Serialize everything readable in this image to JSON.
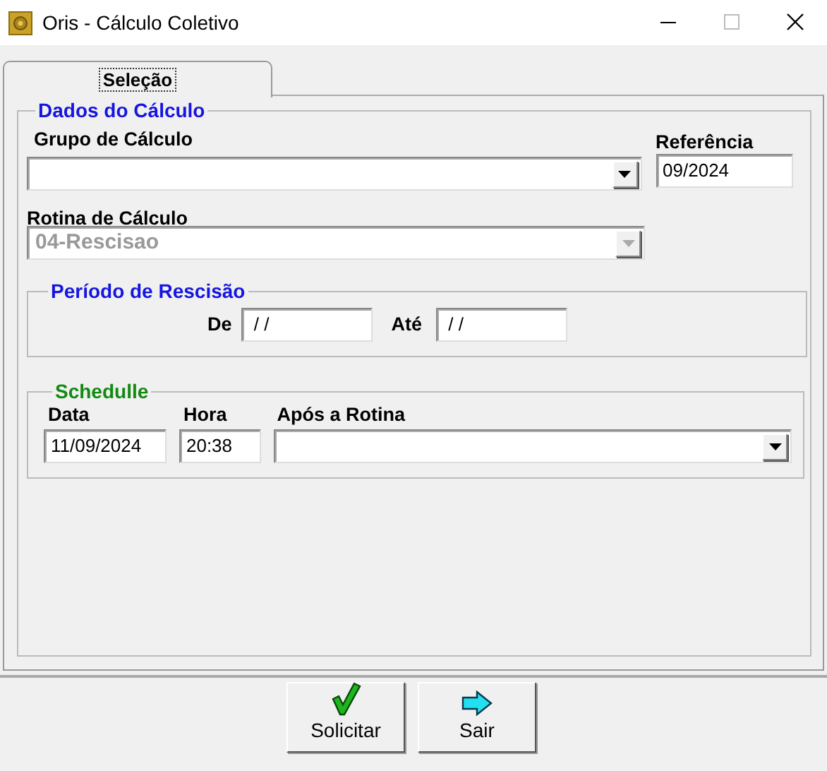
{
  "window": {
    "title": "Oris - Cálculo Coletivo"
  },
  "tabs": [
    {
      "label": "Seleção",
      "selected": true
    }
  ],
  "dados": {
    "legend": "Dados do Cálculo",
    "grupo": {
      "label": "Grupo de Cálculo",
      "disabled": false
    },
    "referencia": {
      "label": "Referência",
      "value": "09/2024"
    },
    "rotina": {
      "label": "Rotina de Cálculo",
      "value": "04-Rescisao",
      "disabled": true
    }
  },
  "periodo": {
    "legend": "Período de Rescisão",
    "de": {
      "label": "De",
      "value": " / /"
    },
    "ate": {
      "label": "Até",
      "value": " / /"
    }
  },
  "schedule": {
    "legend": "Schedulle",
    "data": {
      "label": "Data",
      "value": "11/09/2024"
    },
    "hora": {
      "label": "Hora",
      "value": "20:38"
    },
    "apos": {
      "label": "Após a Rotina",
      "disabled": false
    }
  },
  "buttons": [
    {
      "label": "Solicitar",
      "kind": "check"
    },
    {
      "label": "Sair",
      "kind": "arrow"
    }
  ]
}
